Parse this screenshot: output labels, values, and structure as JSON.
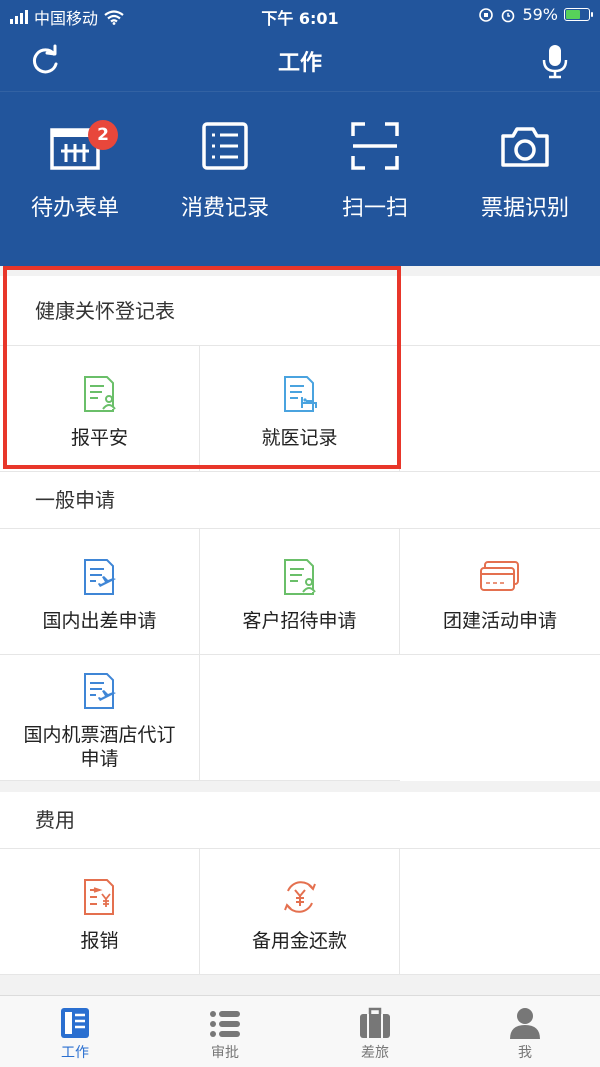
{
  "status_bar": {
    "carrier": "中国移动",
    "time": "下午 6:01",
    "battery": "59%"
  },
  "nav": {
    "title": "工作",
    "left_icon": "refresh-icon",
    "right_icon": "microphone-icon"
  },
  "quick_actions": [
    {
      "label": "待办表单",
      "icon": "todo-form-icon",
      "badge": "2"
    },
    {
      "label": "消费记录",
      "icon": "list-icon"
    },
    {
      "label": "扫一扫",
      "icon": "scan-icon"
    },
    {
      "label": "票据识别",
      "icon": "camera-icon"
    }
  ],
  "sections": [
    {
      "title": "健康关怀登记表",
      "items": [
        {
          "label": "报平安",
          "icon": "document-person-icon",
          "color": "#6abf69"
        },
        {
          "label": "就医记录",
          "icon": "document-bed-icon",
          "color": "#4aa3df"
        }
      ]
    },
    {
      "title": "一般申请",
      "items": [
        {
          "label": "国内出差申请",
          "icon": "document-plane-icon",
          "color": "#3f86d6"
        },
        {
          "label": "客户招待申请",
          "icon": "document-person-icon",
          "color": "#6abf69"
        },
        {
          "label": "团建活动申请",
          "icon": "card-icon",
          "color": "#e4704f"
        },
        {
          "label": "国内机票酒店代订申请",
          "icon": "document-plane-icon",
          "color": "#3f86d6"
        }
      ]
    },
    {
      "title": "费用",
      "items": [
        {
          "label": "报销",
          "icon": "document-yen-icon",
          "color": "#e4704f"
        },
        {
          "label": "备用金还款",
          "icon": "yen-cycle-icon",
          "color": "#e4704f"
        }
      ]
    }
  ],
  "tabs": [
    {
      "label": "工作",
      "icon": "work-icon",
      "active": true
    },
    {
      "label": "审批",
      "icon": "list-icon"
    },
    {
      "label": "差旅",
      "icon": "luggage-icon"
    },
    {
      "label": "我",
      "icon": "person-icon"
    }
  ]
}
